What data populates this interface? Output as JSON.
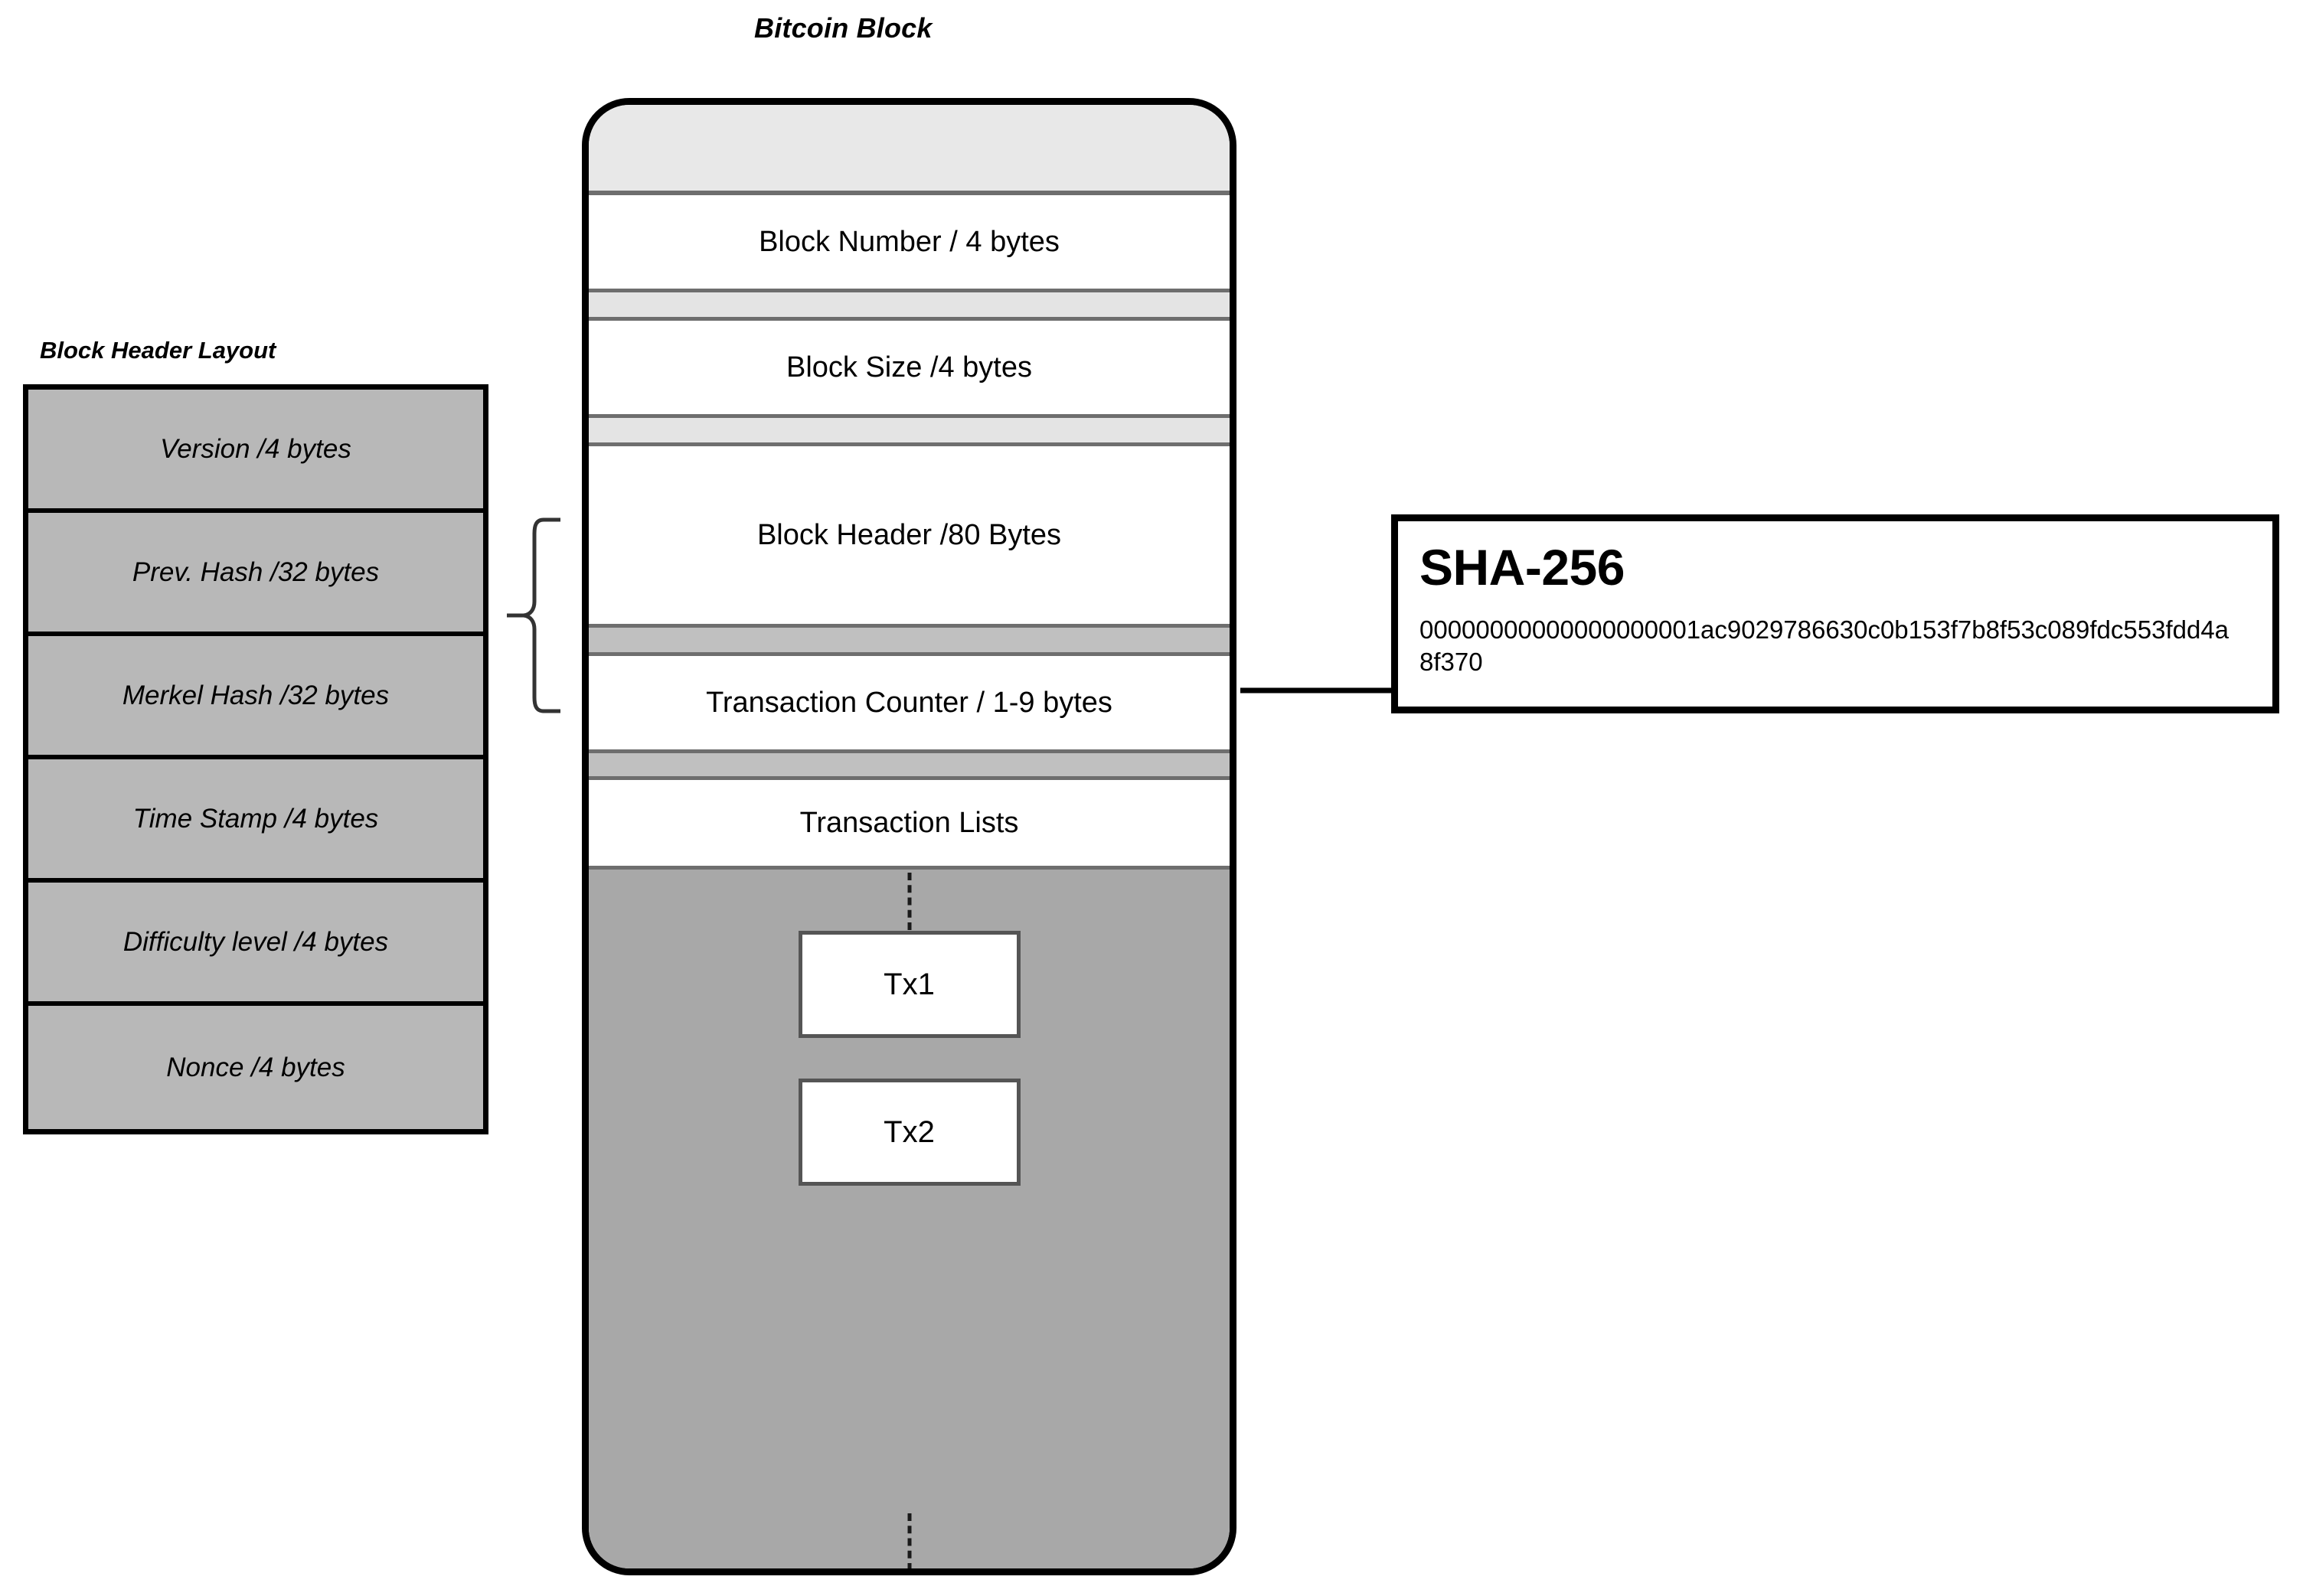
{
  "titles": {
    "bitcoin_block": "Bitcoin Block",
    "block_header_layout": "Block Header Layout"
  },
  "block_header_layout": {
    "fields": [
      {
        "label": "Version /4 bytes"
      },
      {
        "label": "Prev. Hash /32 bytes"
      },
      {
        "label": "Merkel Hash /32 bytes"
      },
      {
        "label": "Time Stamp /4 bytes"
      },
      {
        "label": "Difficulty level /4 bytes"
      },
      {
        "label": "Nonce /4 bytes"
      }
    ]
  },
  "bitcoin_block": {
    "fields": {
      "block_number": "Block Number / 4 bytes",
      "block_size": "Block Size /4 bytes",
      "block_header": "Block Header /80 Bytes",
      "transaction_counter": "Transaction Counter / 1-9 bytes",
      "transaction_lists": "Transaction Lists"
    },
    "transactions": [
      {
        "label": "Tx1"
      },
      {
        "label": "Tx2"
      }
    ]
  },
  "sha": {
    "title": "SHA-256",
    "hash": "00000000000000000001ac9029786630c0b153f7b8f53c089fdc553fdd4a8f370"
  },
  "colors": {
    "outline": "#000000",
    "header_row_fill": "#b8b8b8",
    "band_light": "#e4e4e4",
    "band_medium": "#c0c0c0",
    "tx_area_fill": "#a8a8a8",
    "separator": "#6e6e6e",
    "page_background": "#ffffff"
  }
}
